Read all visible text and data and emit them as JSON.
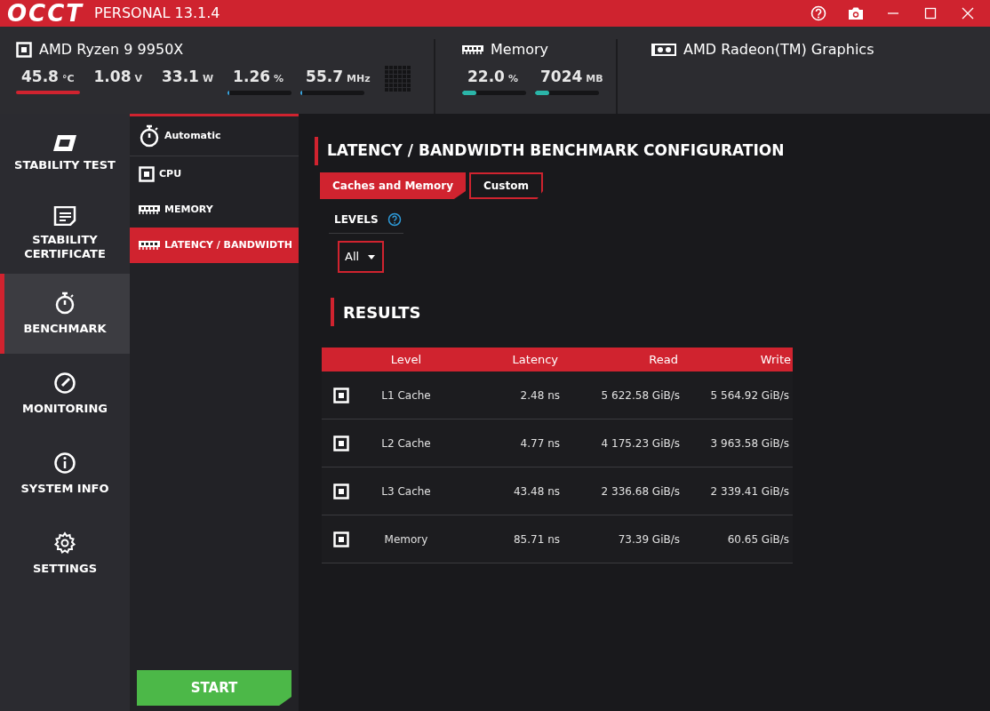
{
  "window": {
    "logo": "OCCT",
    "title": "PERSONAL 13.1.4"
  },
  "cpu": {
    "name": "AMD Ryzen 9 9950X",
    "sensors": [
      {
        "value": "45.8",
        "unit": "°C",
        "kind": "underline"
      },
      {
        "value": "1.08",
        "unit": "V",
        "kind": "plain"
      },
      {
        "value": "33.1",
        "unit": "W",
        "kind": "plain"
      },
      {
        "value": "1.26",
        "unit": "%",
        "kind": "bar",
        "level": 0.02
      },
      {
        "value": "55.7",
        "unit": "MHz",
        "kind": "bar",
        "level": 0.02
      }
    ]
  },
  "memory": {
    "name": "Memory",
    "sensors": [
      {
        "value": "22.0",
        "unit": "%",
        "kind": "bar",
        "level": 0.22
      },
      {
        "value": "7024",
        "unit": "MB",
        "kind": "bar",
        "level": 0.22
      }
    ]
  },
  "gpu": {
    "name": "AMD Radeon(TM) Graphics"
  },
  "nav": [
    {
      "label": "STABILITY TEST",
      "kind": "stability",
      "selected": false
    },
    {
      "label": "STABILITY CERTIFICATE",
      "kind": "certificate",
      "selected": false
    },
    {
      "label": "BENCHMARK",
      "kind": "timer",
      "selected": true
    },
    {
      "label": "MONITORING",
      "kind": "gauge",
      "selected": false
    },
    {
      "label": "SYSTEM INFO",
      "kind": "info",
      "selected": false
    },
    {
      "label": "SETTINGS",
      "kind": "gear",
      "selected": false
    }
  ],
  "subnav": [
    {
      "label": "Automatic",
      "kind": "timer",
      "selected": false
    },
    {
      "label": "CPU",
      "kind": "chip",
      "selected": false
    },
    {
      "label": "MEMORY",
      "kind": "ram",
      "selected": false
    },
    {
      "label": "LATENCY / BANDWIDTH",
      "kind": "ram",
      "selected": true
    }
  ],
  "start_button": "START",
  "config": {
    "title": "LATENCY / BANDWIDTH BENCHMARK CONFIGURATION",
    "tabs": [
      {
        "label": "Caches and Memory",
        "selected": true
      },
      {
        "label": "Custom",
        "selected": false
      }
    ],
    "levels_label": "LEVELS",
    "levels_value": "All"
  },
  "results": {
    "title": "RESULTS",
    "columns": [
      "Level",
      "Latency",
      "Read",
      "Write"
    ],
    "rows": [
      {
        "level": "L1 Cache",
        "latency": "2.48 ns",
        "read": "5 622.58 GiB/s",
        "write": "5 564.92 GiB/s"
      },
      {
        "level": "L2 Cache",
        "latency": "4.77 ns",
        "read": "4 175.23 GiB/s",
        "write": "3 963.58 GiB/s"
      },
      {
        "level": "L3 Cache",
        "latency": "43.48 ns",
        "read": "2 336.68 GiB/s",
        "write": "2 339.41 GiB/s"
      },
      {
        "level": "Memory",
        "latency": "85.71 ns",
        "read": "73.39 GiB/s",
        "write": "60.65 GiB/s"
      }
    ]
  }
}
